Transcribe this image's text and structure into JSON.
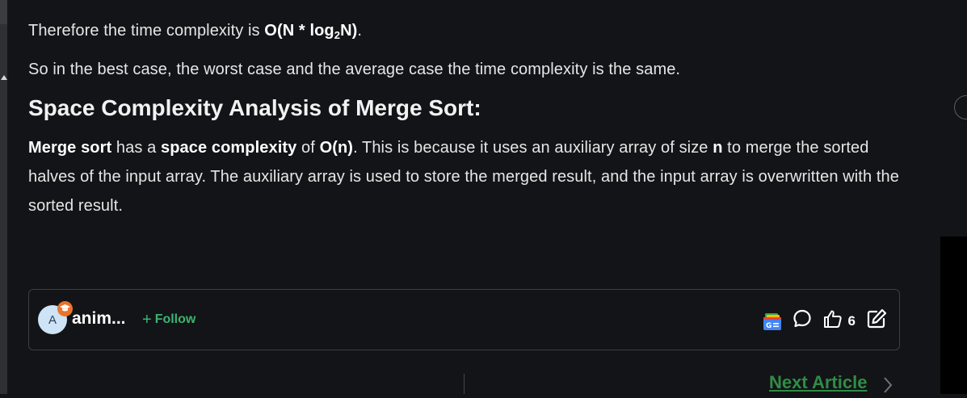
{
  "article": {
    "p1_prefix": "Therefore the time complexity is ",
    "p1_bold_a": "O(N * log",
    "p1_sub": "2",
    "p1_bold_b": "N)",
    "p1_suffix": ".",
    "p2": "So in the best case, the worst case and the average case the time complexity is the same.",
    "heading": "Space Complexity Analysis of Merge Sort:",
    "p3_b1": "Merge sort",
    "p3_t1": " has a ",
    "p3_b2": "space complexity",
    "p3_t2": " of ",
    "p3_b3": "O(n)",
    "p3_t3": ". This is because it uses an auxiliary array of size ",
    "p3_b4": "n",
    "p3_t4": " to merge the sorted halves of the input array. The auxiliary array is used to store the merged result, and the input array is overwritten with the sorted result."
  },
  "author_bar": {
    "avatar_letter": "A",
    "author_name": "anim...",
    "follow_label": "Follow",
    "like_count": "6"
  },
  "navigation": {
    "next_article_label": "Next Article"
  },
  "colors": {
    "background": "#131417",
    "accent_green": "#2f8d46",
    "follow_green": "#3cb371",
    "badge_orange": "#e8742a"
  },
  "icons": [
    "graduation-cap-icon",
    "google-news-icon",
    "comment-icon",
    "thumbs-up-icon",
    "edit-icon",
    "chevron-right-icon"
  ]
}
